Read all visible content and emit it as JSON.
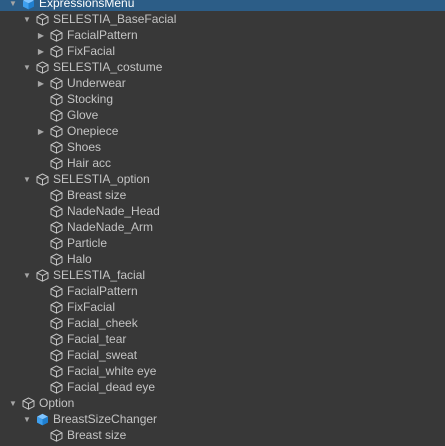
{
  "hierarchy": {
    "items": [
      {
        "label": "ExpressionsMenu",
        "depth": 0,
        "foldout": "expanded",
        "icon": "blue-gameobject-icon",
        "selected": true
      },
      {
        "label": "SELESTIA_BaseFacial",
        "depth": 1,
        "foldout": "expanded",
        "icon": "gameobject-icon"
      },
      {
        "label": "FacialPattern",
        "depth": 2,
        "foldout": "collapsed",
        "icon": "gameobject-icon"
      },
      {
        "label": "FixFacial",
        "depth": 2,
        "foldout": "collapsed",
        "icon": "gameobject-icon"
      },
      {
        "label": "SELESTIA_costume",
        "depth": 1,
        "foldout": "expanded",
        "icon": "gameobject-icon"
      },
      {
        "label": "Underwear",
        "depth": 2,
        "foldout": "collapsed",
        "icon": "gameobject-icon"
      },
      {
        "label": "Stocking",
        "depth": 2,
        "foldout": "none",
        "icon": "gameobject-icon"
      },
      {
        "label": "Glove",
        "depth": 2,
        "foldout": "none",
        "icon": "gameobject-icon"
      },
      {
        "label": "Onepiece",
        "depth": 2,
        "foldout": "collapsed",
        "icon": "gameobject-icon"
      },
      {
        "label": "Shoes",
        "depth": 2,
        "foldout": "none",
        "icon": "gameobject-icon"
      },
      {
        "label": "Hair acc",
        "depth": 2,
        "foldout": "none",
        "icon": "gameobject-icon"
      },
      {
        "label": "SELESTIA_option",
        "depth": 1,
        "foldout": "expanded",
        "icon": "gameobject-icon"
      },
      {
        "label": "Breast size",
        "depth": 2,
        "foldout": "none",
        "icon": "gameobject-icon"
      },
      {
        "label": "NadeNade_Head",
        "depth": 2,
        "foldout": "none",
        "icon": "gameobject-icon"
      },
      {
        "label": "NadeNade_Arm",
        "depth": 2,
        "foldout": "none",
        "icon": "gameobject-icon"
      },
      {
        "label": "Particle",
        "depth": 2,
        "foldout": "none",
        "icon": "gameobject-icon"
      },
      {
        "label": "Halo",
        "depth": 2,
        "foldout": "none",
        "icon": "gameobject-icon"
      },
      {
        "label": "SELESTIA_facial",
        "depth": 1,
        "foldout": "expanded",
        "icon": "gameobject-icon"
      },
      {
        "label": "FacialPattern",
        "depth": 2,
        "foldout": "none",
        "icon": "gameobject-icon"
      },
      {
        "label": "FixFacial",
        "depth": 2,
        "foldout": "none",
        "icon": "gameobject-icon"
      },
      {
        "label": "Facial_cheek",
        "depth": 2,
        "foldout": "none",
        "icon": "gameobject-icon"
      },
      {
        "label": "Facial_tear",
        "depth": 2,
        "foldout": "none",
        "icon": "gameobject-icon"
      },
      {
        "label": "Facial_sweat",
        "depth": 2,
        "foldout": "none",
        "icon": "gameobject-icon"
      },
      {
        "label": "Facial_white eye",
        "depth": 2,
        "foldout": "none",
        "icon": "gameobject-icon"
      },
      {
        "label": "Facial_dead eye",
        "depth": 2,
        "foldout": "none",
        "icon": "gameobject-icon"
      },
      {
        "label": "Option",
        "depth": 0,
        "foldout": "expanded",
        "icon": "gameobject-icon"
      },
      {
        "label": "BreastSizeChanger",
        "depth": 1,
        "foldout": "expanded",
        "icon": "blue-gameobject-icon"
      },
      {
        "label": "Breast size",
        "depth": 2,
        "foldout": "none",
        "icon": "gameobject-icon"
      }
    ]
  },
  "colors": {
    "background": "#383838",
    "selected_row": "#2c5d87",
    "text": "#c4c4c4",
    "icon_outline": "#c4c4c4",
    "blue_icon": "#3ea0f0"
  }
}
